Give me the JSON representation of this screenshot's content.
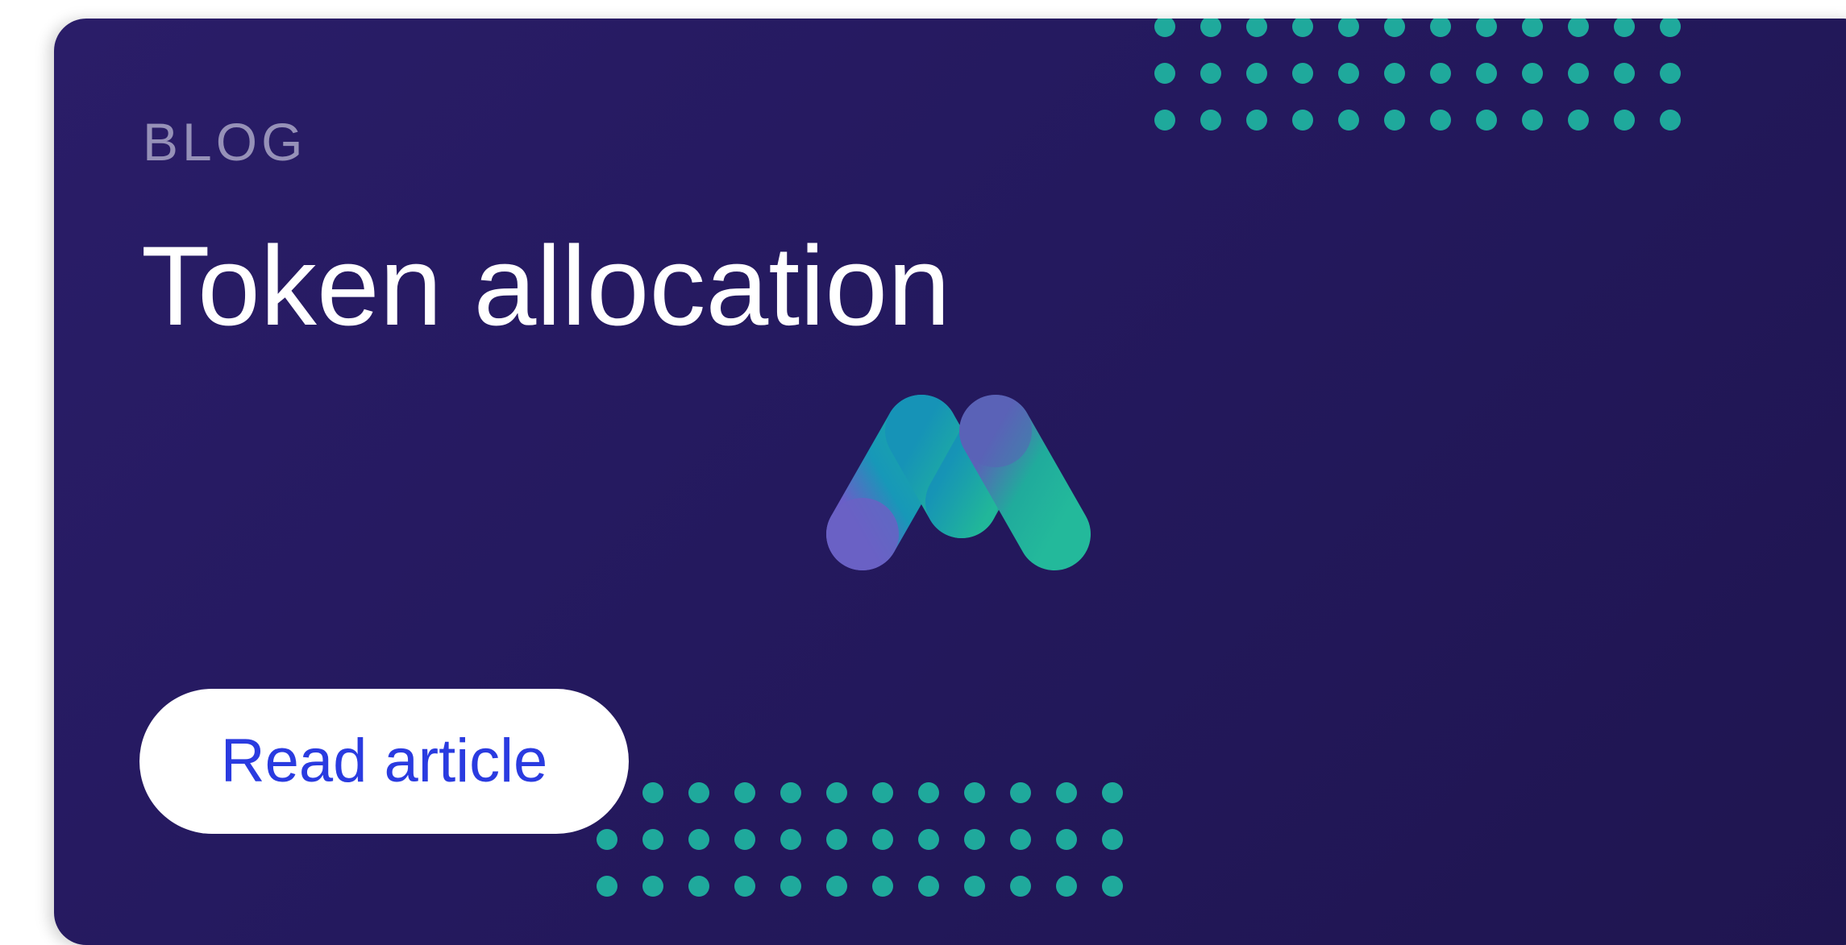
{
  "card": {
    "eyebrow": "BLOG",
    "title": "Token allocation",
    "cta_label": "Read article"
  },
  "colors": {
    "card_background": "#24195e",
    "dot_accent": "#1fa99c",
    "cta_text": "#2a3be0",
    "eyebrow_text": "#9691b8"
  },
  "icons": [
    "brand-logo-icon",
    "dot-grid-pattern"
  ]
}
